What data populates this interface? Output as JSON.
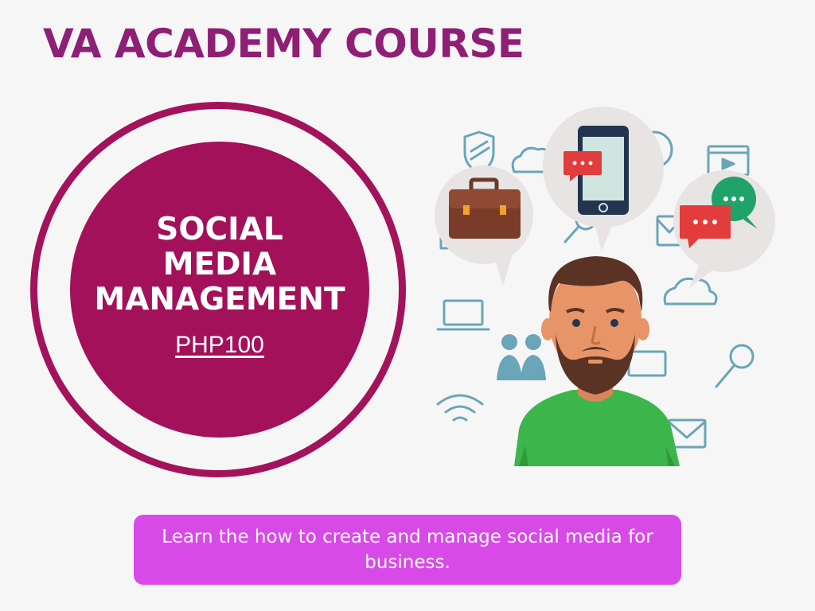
{
  "header": {
    "title": "VA ACADEMY COURSE"
  },
  "course_badge": {
    "title_lines": [
      "SOCIAL",
      "MEDIA",
      "MANAGEMENT"
    ],
    "price": "PHP100"
  },
  "description": {
    "text": "Learn the how to create and manage social media for business."
  },
  "colors": {
    "title": "#8e1f75",
    "badge": "#a3115a",
    "description_box": "#d84ae8",
    "icon_teal": "#6aa5b8"
  },
  "illustration": {
    "icons": [
      "shield-icon",
      "cloud-icon",
      "globe-icon",
      "video-icon",
      "briefcase-icon",
      "smartphone-icon",
      "chat-bubble-icon",
      "email-icon",
      "magnifier-icon",
      "laptop-icon",
      "users-icon",
      "wifi-icon",
      "person-icon"
    ]
  }
}
